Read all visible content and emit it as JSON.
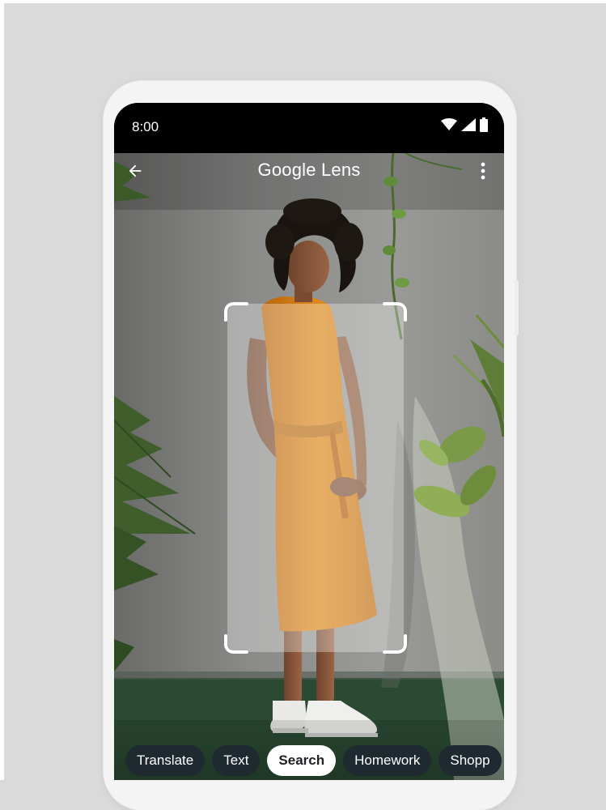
{
  "status_bar": {
    "time": "8:00",
    "icons": [
      "wifi-icon",
      "cellular-signal-icon",
      "battery-icon"
    ]
  },
  "app_bar": {
    "title": "Google Lens",
    "back_icon": "arrow-back-icon",
    "menu_icon": "more-vert-icon"
  },
  "modes": [
    {
      "label": "Translate",
      "active": false
    },
    {
      "label": "Text",
      "active": false
    },
    {
      "label": "Search",
      "active": true
    },
    {
      "label": "Homework",
      "active": false
    },
    {
      "label": "Shopp",
      "active": false
    }
  ],
  "colors": {
    "page_background": "#dadada",
    "chip_background": "#1f2a30",
    "chip_active_background": "#ffffff",
    "dress": "#d8861a"
  }
}
